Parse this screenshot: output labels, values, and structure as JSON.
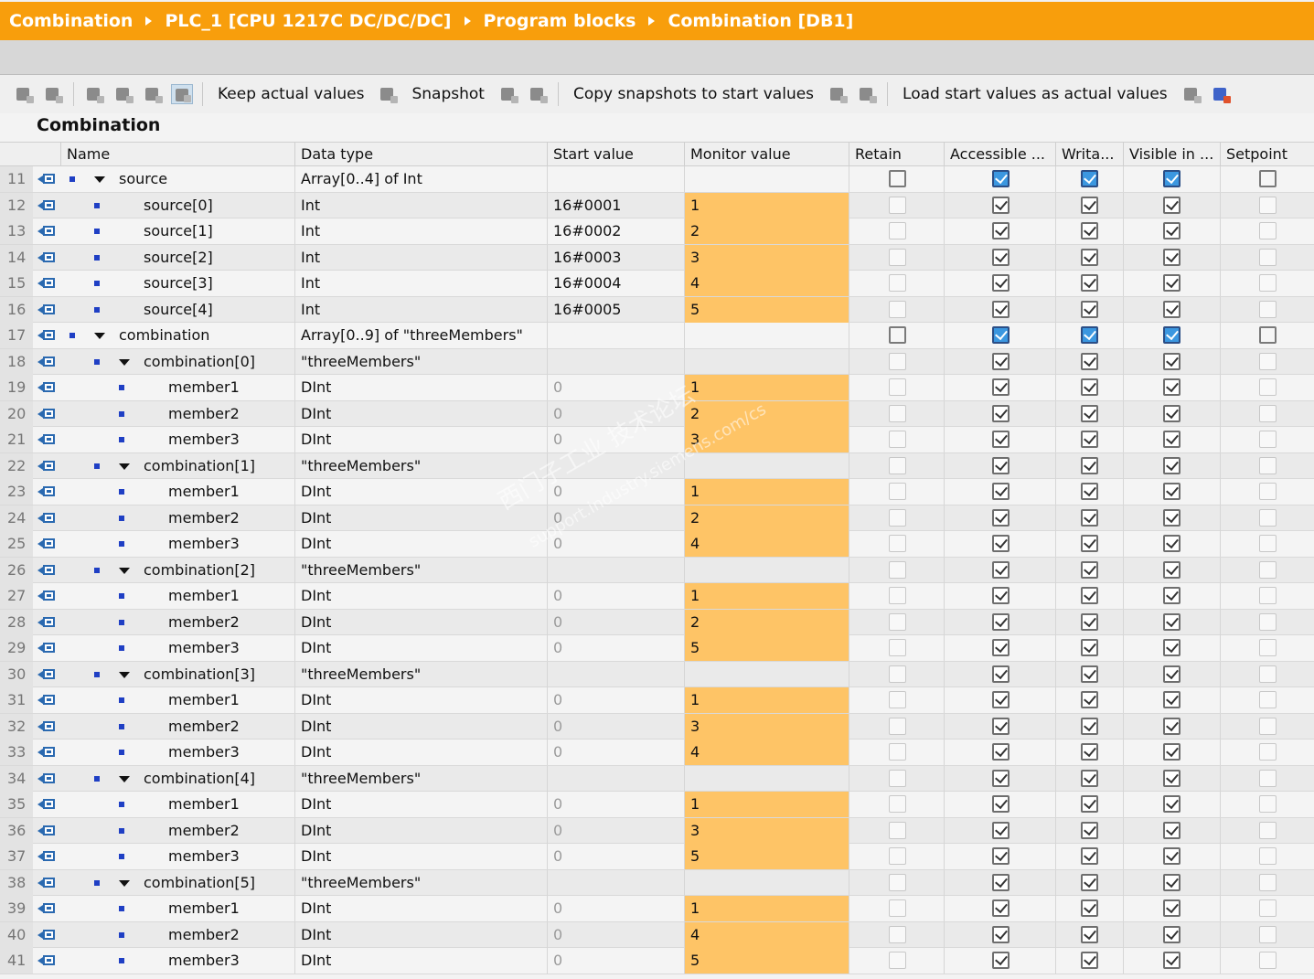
{
  "breadcrumb": [
    "Combination",
    "PLC_1 [CPU 1217C DC/DC/DC]",
    "Program blocks",
    "Combination [DB1]"
  ],
  "toolbar": {
    "keep_actual_values": "Keep actual values",
    "snapshot": "Snapshot",
    "copy_snapshots": "Copy snapshots to start values",
    "load_start_values": "Load start values as actual values"
  },
  "section_title": "Combination",
  "columns": {
    "name": "Name",
    "data_type": "Data type",
    "start_value": "Start value",
    "monitor_value": "Monitor value",
    "retain": "Retain",
    "accessible": "Accessible ...",
    "writable": "Writa...",
    "visible": "Visible in ...",
    "setpoint": "Setpoint"
  },
  "watermark": {
    "line1": "西门子工业 技术论坛",
    "line2": "support.industry.siemens.com/cs"
  },
  "rows": [
    {
      "num": "11",
      "level": 0,
      "expand": true,
      "name": "source",
      "type": "Array[0..4] of Int",
      "start": "",
      "monitor": "",
      "top": true
    },
    {
      "num": "12",
      "level": 1,
      "expand": false,
      "name": "source[0]",
      "type": "Int",
      "start": "16#0001",
      "monitor": "1"
    },
    {
      "num": "13",
      "level": 1,
      "expand": false,
      "name": "source[1]",
      "type": "Int",
      "start": "16#0002",
      "monitor": "2"
    },
    {
      "num": "14",
      "level": 1,
      "expand": false,
      "name": "source[2]",
      "type": "Int",
      "start": "16#0003",
      "monitor": "3"
    },
    {
      "num": "15",
      "level": 1,
      "expand": false,
      "name": "source[3]",
      "type": "Int",
      "start": "16#0004",
      "monitor": "4"
    },
    {
      "num": "16",
      "level": 1,
      "expand": false,
      "name": "source[4]",
      "type": "Int",
      "start": "16#0005",
      "monitor": "5"
    },
    {
      "num": "17",
      "level": 0,
      "expand": true,
      "name": "combination",
      "type": "Array[0..9] of \"threeMembers\"",
      "start": "",
      "monitor": "",
      "top": true
    },
    {
      "num": "18",
      "level": 1,
      "expand": true,
      "name": "combination[0]",
      "type": "\"threeMembers\"",
      "start": "",
      "monitor": ""
    },
    {
      "num": "19",
      "level": 2,
      "expand": false,
      "name": "member1",
      "type": "DInt",
      "start": "0",
      "monitor": "1",
      "greyStart": true
    },
    {
      "num": "20",
      "level": 2,
      "expand": false,
      "name": "member2",
      "type": "DInt",
      "start": "0",
      "monitor": "2",
      "greyStart": true
    },
    {
      "num": "21",
      "level": 2,
      "expand": false,
      "name": "member3",
      "type": "DInt",
      "start": "0",
      "monitor": "3",
      "greyStart": true
    },
    {
      "num": "22",
      "level": 1,
      "expand": true,
      "name": "combination[1]",
      "type": "\"threeMembers\"",
      "start": "",
      "monitor": ""
    },
    {
      "num": "23",
      "level": 2,
      "expand": false,
      "name": "member1",
      "type": "DInt",
      "start": "0",
      "monitor": "1",
      "greyStart": true
    },
    {
      "num": "24",
      "level": 2,
      "expand": false,
      "name": "member2",
      "type": "DInt",
      "start": "0",
      "monitor": "2",
      "greyStart": true
    },
    {
      "num": "25",
      "level": 2,
      "expand": false,
      "name": "member3",
      "type": "DInt",
      "start": "0",
      "monitor": "4",
      "greyStart": true
    },
    {
      "num": "26",
      "level": 1,
      "expand": true,
      "name": "combination[2]",
      "type": "\"threeMembers\"",
      "start": "",
      "monitor": ""
    },
    {
      "num": "27",
      "level": 2,
      "expand": false,
      "name": "member1",
      "type": "DInt",
      "start": "0",
      "monitor": "1",
      "greyStart": true
    },
    {
      "num": "28",
      "level": 2,
      "expand": false,
      "name": "member2",
      "type": "DInt",
      "start": "0",
      "monitor": "2",
      "greyStart": true
    },
    {
      "num": "29",
      "level": 2,
      "expand": false,
      "name": "member3",
      "type": "DInt",
      "start": "0",
      "monitor": "5",
      "greyStart": true
    },
    {
      "num": "30",
      "level": 1,
      "expand": true,
      "name": "combination[3]",
      "type": "\"threeMembers\"",
      "start": "",
      "monitor": ""
    },
    {
      "num": "31",
      "level": 2,
      "expand": false,
      "name": "member1",
      "type": "DInt",
      "start": "0",
      "monitor": "1",
      "greyStart": true
    },
    {
      "num": "32",
      "level": 2,
      "expand": false,
      "name": "member2",
      "type": "DInt",
      "start": "0",
      "monitor": "3",
      "greyStart": true
    },
    {
      "num": "33",
      "level": 2,
      "expand": false,
      "name": "member3",
      "type": "DInt",
      "start": "0",
      "monitor": "4",
      "greyStart": true
    },
    {
      "num": "34",
      "level": 1,
      "expand": true,
      "name": "combination[4]",
      "type": "\"threeMembers\"",
      "start": "",
      "monitor": ""
    },
    {
      "num": "35",
      "level": 2,
      "expand": false,
      "name": "member1",
      "type": "DInt",
      "start": "0",
      "monitor": "1",
      "greyStart": true
    },
    {
      "num": "36",
      "level": 2,
      "expand": false,
      "name": "member2",
      "type": "DInt",
      "start": "0",
      "monitor": "3",
      "greyStart": true
    },
    {
      "num": "37",
      "level": 2,
      "expand": false,
      "name": "member3",
      "type": "DInt",
      "start": "0",
      "monitor": "5",
      "greyStart": true
    },
    {
      "num": "38",
      "level": 1,
      "expand": true,
      "name": "combination[5]",
      "type": "\"threeMembers\"",
      "start": "",
      "monitor": ""
    },
    {
      "num": "39",
      "level": 2,
      "expand": false,
      "name": "member1",
      "type": "DInt",
      "start": "0",
      "monitor": "1",
      "greyStart": true
    },
    {
      "num": "40",
      "level": 2,
      "expand": false,
      "name": "member2",
      "type": "DInt",
      "start": "0",
      "monitor": "4",
      "greyStart": true
    },
    {
      "num": "41",
      "level": 2,
      "expand": false,
      "name": "member3",
      "type": "DInt",
      "start": "0",
      "monitor": "5",
      "greyStart": true
    }
  ],
  "colors": {
    "title_bar": "#f89e0c",
    "monitor_highlight": "#fec466",
    "checkbox_blue": "#3b97e0",
    "marker_blue": "#1f3fc4"
  },
  "icons": {
    "interface": "db-interface-icon",
    "toolbar": [
      "insert-row-icon",
      "add-row-icon",
      "expand-icon",
      "collapse-icon",
      "list-icon",
      "monitor-icon",
      "keep-values-icon",
      "snapshot-icon",
      "copy-icon",
      "load-icon",
      "download-icon"
    ]
  }
}
